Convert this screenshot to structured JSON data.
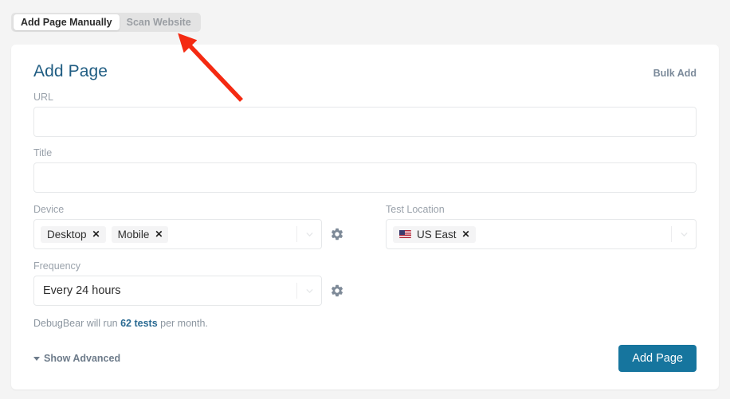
{
  "tabs": [
    {
      "label": "Add Page Manually",
      "active": true
    },
    {
      "label": "Scan Website",
      "active": false
    }
  ],
  "card": {
    "title": "Add Page",
    "bulk_add_label": "Bulk Add",
    "fields": {
      "url": {
        "label": "URL",
        "value": "",
        "placeholder": ""
      },
      "title": {
        "label": "Title",
        "value": "",
        "placeholder": ""
      },
      "device": {
        "label": "Device",
        "tags": [
          "Desktop",
          "Mobile"
        ],
        "remove_glyph": "✕"
      },
      "test_location": {
        "label": "Test Location",
        "tags": [
          "US East"
        ],
        "flag": "🇺🇸",
        "remove_glyph": "✕"
      },
      "frequency": {
        "label": "Frequency",
        "value": "Every 24 hours"
      }
    },
    "helper": {
      "prefix": "DebugBear will run ",
      "highlight": "62 tests",
      "suffix": " per month."
    },
    "footer": {
      "show_advanced_label": "Show Advanced",
      "submit_label": "Add Page"
    }
  },
  "colors": {
    "page_bg": "#f4f4f4",
    "card_bg": "#ffffff",
    "title": "#1f5c82",
    "primary_button": "#16759e",
    "annotation_arrow": "#f42a12",
    "muted_text": "#9aa2ab"
  }
}
